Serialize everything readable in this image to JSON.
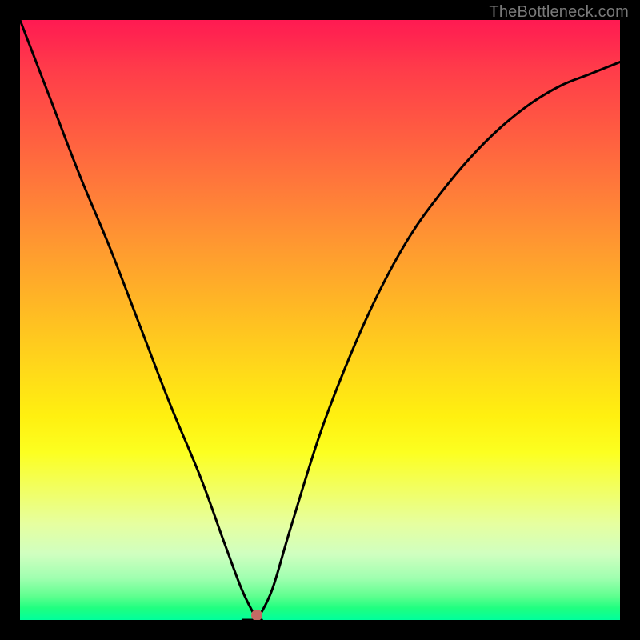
{
  "watermark": "TheBottleneck.com",
  "marker": {
    "x_frac": 0.395,
    "y_frac": 0.992,
    "color": "#c46a64"
  },
  "chart_data": {
    "type": "line",
    "title": "",
    "xlabel": "",
    "ylabel": "",
    "xlim": [
      0,
      1
    ],
    "ylim": [
      0,
      1
    ],
    "series": [
      {
        "name": "bottleneck-curve",
        "x": [
          0.0,
          0.05,
          0.1,
          0.15,
          0.2,
          0.25,
          0.3,
          0.34,
          0.37,
          0.395,
          0.42,
          0.45,
          0.5,
          0.55,
          0.6,
          0.65,
          0.7,
          0.75,
          0.8,
          0.85,
          0.9,
          0.95,
          1.0
        ],
        "y": [
          1.0,
          0.87,
          0.74,
          0.62,
          0.49,
          0.36,
          0.24,
          0.13,
          0.05,
          0.0,
          0.05,
          0.15,
          0.31,
          0.44,
          0.55,
          0.64,
          0.71,
          0.77,
          0.82,
          0.86,
          0.89,
          0.91,
          0.93
        ]
      }
    ],
    "gradient": {
      "top_color": "#ff1a52",
      "bottom_color": "#00ff9c"
    },
    "annotations": []
  }
}
